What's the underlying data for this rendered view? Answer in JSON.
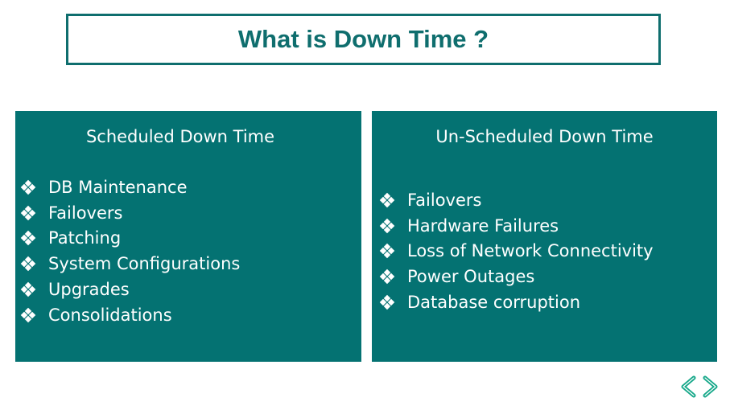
{
  "title": "What is Down Time ?",
  "colors": {
    "accent": "#0f6e6e",
    "panel": "#047272",
    "arrow": "#1fb88a"
  },
  "scheduled": {
    "heading": "Scheduled Down Time",
    "bullet_icon": "four-diamond-bullet",
    "items": [
      "DB Maintenance",
      "Failovers",
      "Patching",
      "System Configurations",
      "Upgrades",
      "Consolidations"
    ]
  },
  "unscheduled": {
    "heading": "Un-Scheduled Down Time",
    "bullet_icon": "four-diamond-bullet",
    "items": [
      "Failovers",
      "Hardware Failures",
      "Loss of Network Connectivity",
      "Power Outages",
      "Database corruption"
    ]
  },
  "nav": {
    "prev_icon": "chevron-left-icon",
    "next_icon": "chevron-right-icon"
  }
}
